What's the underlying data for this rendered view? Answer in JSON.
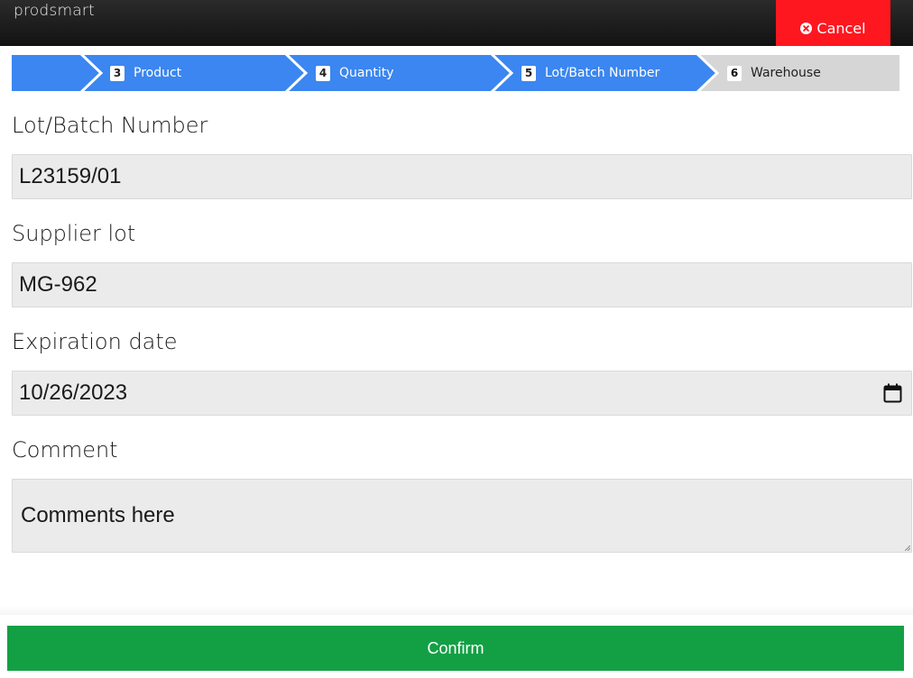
{
  "header": {
    "brand": "prodsmart",
    "cancel_label": "Cancel"
  },
  "wizard": {
    "steps": [
      {
        "number": "3",
        "label": "Product",
        "state": "done"
      },
      {
        "number": "4",
        "label": "Quantity",
        "state": "done"
      },
      {
        "number": "5",
        "label": "Lot/Batch Number",
        "state": "current"
      },
      {
        "number": "6",
        "label": "Warehouse",
        "state": "todo"
      }
    ]
  },
  "form": {
    "lot_label": "Lot/Batch Number",
    "lot_value": "L23159/01",
    "supplier_label": "Supplier lot",
    "supplier_value": "MG-962",
    "expiration_label": "Expiration date",
    "expiration_value": "10/26/2023",
    "comment_label": "Comment",
    "comment_placeholder": "Comments here"
  },
  "footer": {
    "confirm_label": "Confirm"
  },
  "colors": {
    "topbar": "#1a1a1a",
    "cancel": "#ff1720",
    "step_active": "#3b86f0",
    "step_inactive": "#d6d6d6",
    "confirm": "#13a044",
    "field_bg": "#ebebeb"
  },
  "icons": {
    "cancel": "times-circle-icon",
    "calendar": "calendar-icon"
  }
}
